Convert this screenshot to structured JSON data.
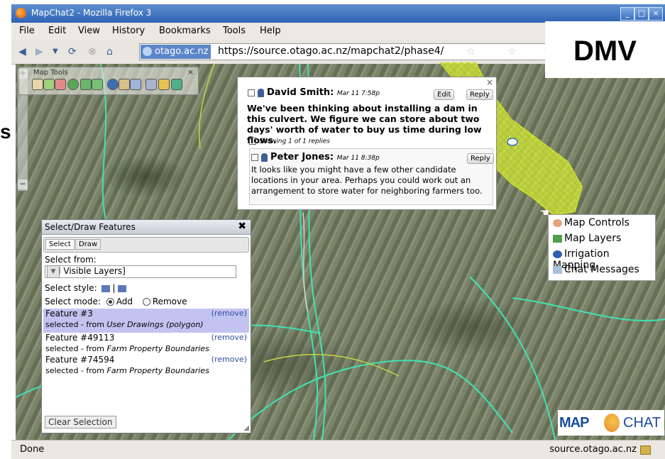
{
  "window": {
    "title": "MapChat2 - Mozilla Firefox 3",
    "controls": [
      "_",
      "□",
      "×"
    ]
  },
  "menubar": {
    "items": [
      "File",
      "Edit",
      "View",
      "History",
      "Bookmarks",
      "Tools",
      "Help"
    ]
  },
  "navbar": {
    "site_badge": "otago.ac.nz",
    "url": "https://source.otago.ac.nz/mapchat2/phase4/"
  },
  "overlay": {
    "label": "DMV",
    "side_char": "s"
  },
  "map_tools": {
    "title": "Map Tools",
    "close": "×",
    "zoom_in": "+",
    "zoom_out": "−"
  },
  "chat": {
    "close": "×",
    "post": {
      "author": "David Smith:",
      "date": "Mar 11 7:58p",
      "edit": "Edit",
      "reply": "Reply",
      "text": "We've been thinking about installing a dam in this culvert.  We figure we can store about two days' worth of water to buy us time during low flows."
    },
    "showing": "Showing 1 of 1 replies",
    "reply": {
      "author": "Peter Jones:",
      "date": "Mar 11 8:38p",
      "reply": "Reply",
      "text": "It looks like you might have a few other candidate locations in your area.  Perhaps you could work out an arrangement to store water for neighboring farmers too."
    }
  },
  "context_menu": {
    "items": [
      {
        "label": "Map Controls",
        "icon": "magnifier-icon"
      },
      {
        "label": "Map Layers",
        "icon": "layers-icon"
      },
      {
        "label": "Irrigation Mapping",
        "icon": "drop-icon"
      },
      {
        "label": "Chat Messages",
        "icon": "chat-icon"
      }
    ]
  },
  "select_draw": {
    "title": "Select/Draw Features",
    "close": "✖",
    "tabs": [
      "Select",
      "Draw"
    ],
    "select_from_label": "Select from:",
    "select_from_value": "[All Visible Layers]",
    "select_style_label": "Select style:",
    "select_mode_label": "Select mode:",
    "mode_add": "Add",
    "mode_remove": "Remove",
    "features": [
      {
        "name": "Feature #3",
        "remove": "(remove)",
        "src_prefix": "selected - from ",
        "src": "User Drawings (polygon)",
        "highlight": true
      },
      {
        "name": "Feature #49113",
        "remove": "(remove)",
        "src_prefix": "selected - from ",
        "src": "Farm Property Boundaries",
        "highlight": false
      },
      {
        "name": "Feature #74594",
        "remove": "(remove)",
        "src_prefix": "selected - from ",
        "src": "Farm Property Boundaries",
        "highlight": false
      }
    ],
    "clear_button": "Clear Selection"
  },
  "logo": {
    "left": "MAP",
    "right": "CHAT"
  },
  "statusbar": {
    "left": "Done",
    "right": "source.otago.ac.nz"
  },
  "colors": {
    "feature_highlight": "#c3c3f2",
    "irrigation_polygon": "#d8ee3c",
    "property_lines": "#3fe3b4"
  }
}
